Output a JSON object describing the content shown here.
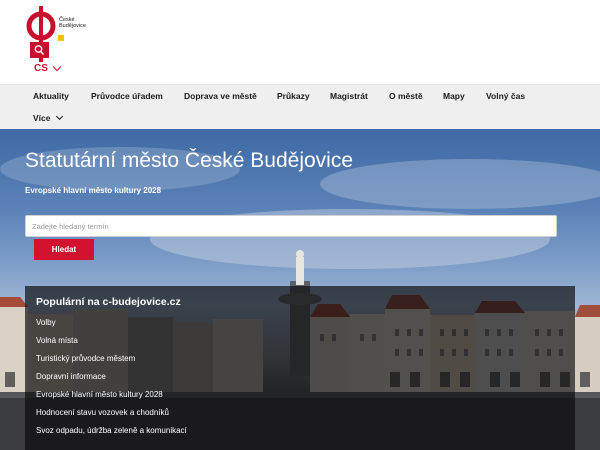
{
  "logo": {
    "text_line1": "České",
    "text_line2": "Budějovice",
    "brand_color": "#c8102e",
    "accent_color": "#f2c400"
  },
  "language": {
    "current": "CS"
  },
  "nav": {
    "items": [
      "Aktuality",
      "Průvodce úřadem",
      "Doprava ve městě",
      "Průkazy",
      "Magistrát",
      "O městě",
      "Mapy",
      "Volný čas",
      "Více"
    ]
  },
  "hero": {
    "title": "Statutární město České Budějovice",
    "subtitle": "Evropské hlavní město kultury 2028",
    "search_placeholder": "Zadejte hledaný termín",
    "search_button": "Hledat"
  },
  "popular": {
    "title": "Populární na c-budejovice.cz",
    "links": [
      "Volby",
      "Volná místa",
      "Turistický průvodce městem",
      "Dopravní informace",
      "Evropské hlavní město kultury 2028",
      "Hodnocení stavu vozovek a chodníků",
      "Svoz odpadu, údržba zeleně a komunikací"
    ]
  }
}
